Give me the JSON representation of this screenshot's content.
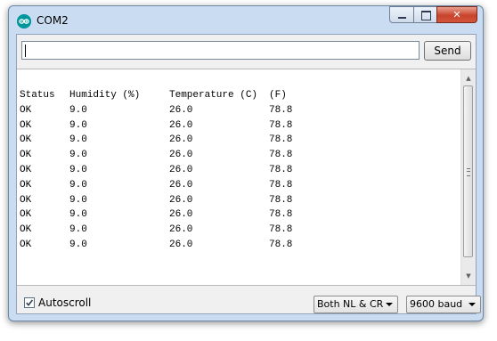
{
  "window": {
    "title": "COM2",
    "close_glyph": "✕"
  },
  "input": {
    "value": "",
    "send_label": "Send"
  },
  "serial_output": {
    "header": [
      "Status",
      "Humidity (%)",
      "Temperature (C)",
      "(F)"
    ],
    "rows": [
      [
        "OK",
        "9.0",
        "26.0",
        "78.8"
      ],
      [
        "OK",
        "9.0",
        "26.0",
        "78.8"
      ],
      [
        "OK",
        "9.0",
        "26.0",
        "78.8"
      ],
      [
        "OK",
        "9.0",
        "26.0",
        "78.8"
      ],
      [
        "OK",
        "9.0",
        "26.0",
        "78.8"
      ],
      [
        "OK",
        "9.0",
        "26.0",
        "78.8"
      ],
      [
        "OK",
        "9.0",
        "26.0",
        "78.8"
      ],
      [
        "OK",
        "9.0",
        "26.0",
        "78.8"
      ],
      [
        "OK",
        "9.0",
        "26.0",
        "78.8"
      ],
      [
        "OK",
        "9.0",
        "26.0",
        "78.8"
      ]
    ]
  },
  "footer": {
    "autoscroll_label": "Autoscroll",
    "autoscroll_checked": true,
    "line_ending": "Both NL & CR",
    "baud_rate": "9600 baud"
  },
  "colors": {
    "frame": "#c9dcf2",
    "close_button": "#c8442c",
    "app_icon": "#00979c"
  },
  "icons": {
    "app": "arduino-infinity-icon",
    "minimize": "minimize-icon",
    "maximize": "maximize-icon",
    "close": "close-icon",
    "scroll_up": "chevron-up-icon",
    "scroll_down": "chevron-down-icon",
    "dropdown": "chevron-down-icon",
    "checkbox": "checkmark-icon"
  }
}
